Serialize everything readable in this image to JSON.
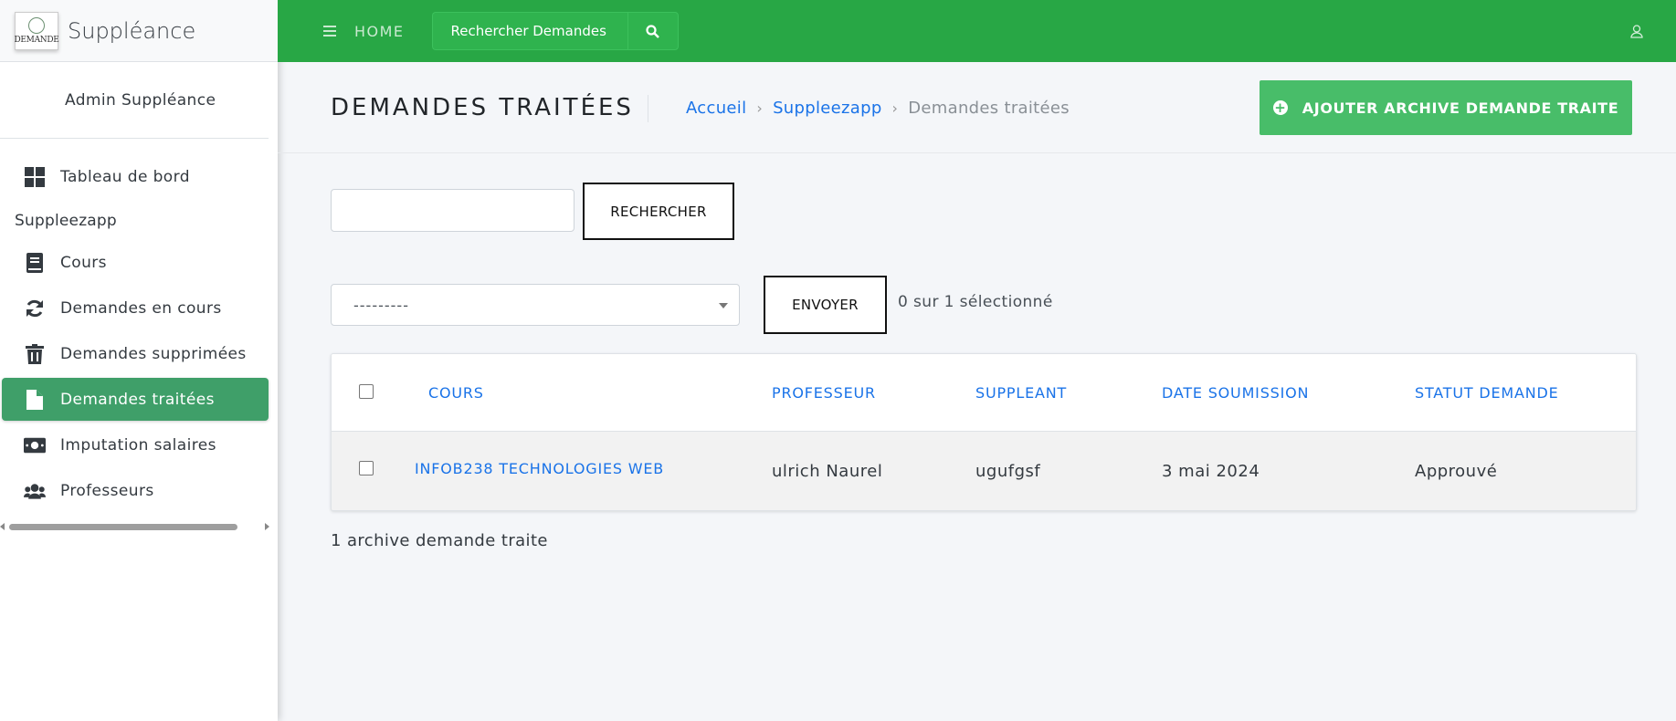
{
  "brand": {
    "name": "Suppléance",
    "logo_text": "DEMANDE"
  },
  "user": {
    "name": "Admin Suppléance"
  },
  "sidebar": {
    "items_top": [
      {
        "label": "Tableau de bord",
        "icon": "dashboard-icon"
      }
    ],
    "section_header": "Suppleezapp",
    "items": [
      {
        "label": "Cours",
        "icon": "book-icon"
      },
      {
        "label": "Demandes en cours",
        "icon": "refresh-icon"
      },
      {
        "label": "Demandes supprimées",
        "icon": "trash-icon"
      },
      {
        "label": "Demandes traitées",
        "icon": "file-icon",
        "active": true
      },
      {
        "label": "Imputation salaires",
        "icon": "money-icon"
      },
      {
        "label": "Professeurs",
        "icon": "users-icon"
      }
    ]
  },
  "topbar": {
    "home_label": "HOME",
    "search_value": "Rechercher Demandes"
  },
  "header": {
    "title": "DEMANDES TRAITÉES",
    "breadcrumb": [
      "Accueil",
      "Suppleezapp",
      "Demandes traitées"
    ],
    "add_button": "AJOUTER ARCHIVE DEMANDE TRAITE"
  },
  "search": {
    "input_value": "",
    "button": "RECHERCHER"
  },
  "actions": {
    "select_value": "---------",
    "send_button": "ENVOYER",
    "selected_count": "0 sur 1 sélectionné"
  },
  "table": {
    "columns": [
      "COURS",
      "PROFESSEUR",
      "SUPPLEANT",
      "DATE SOUMISSION",
      "STATUT DEMANDE"
    ],
    "rows": [
      [
        "INFOB238 TECHNOLOGIES WEB",
        "ulrich Naurel",
        "ugufgsf",
        "3 mai 2024",
        "Approuvé"
      ]
    ]
  },
  "footer": {
    "count": "1 archive demande traite"
  },
  "colors": {
    "topbar": "#28a745",
    "active_nav": "#3f9f69",
    "add_button": "#48bd69",
    "link": "#1a73e8"
  }
}
